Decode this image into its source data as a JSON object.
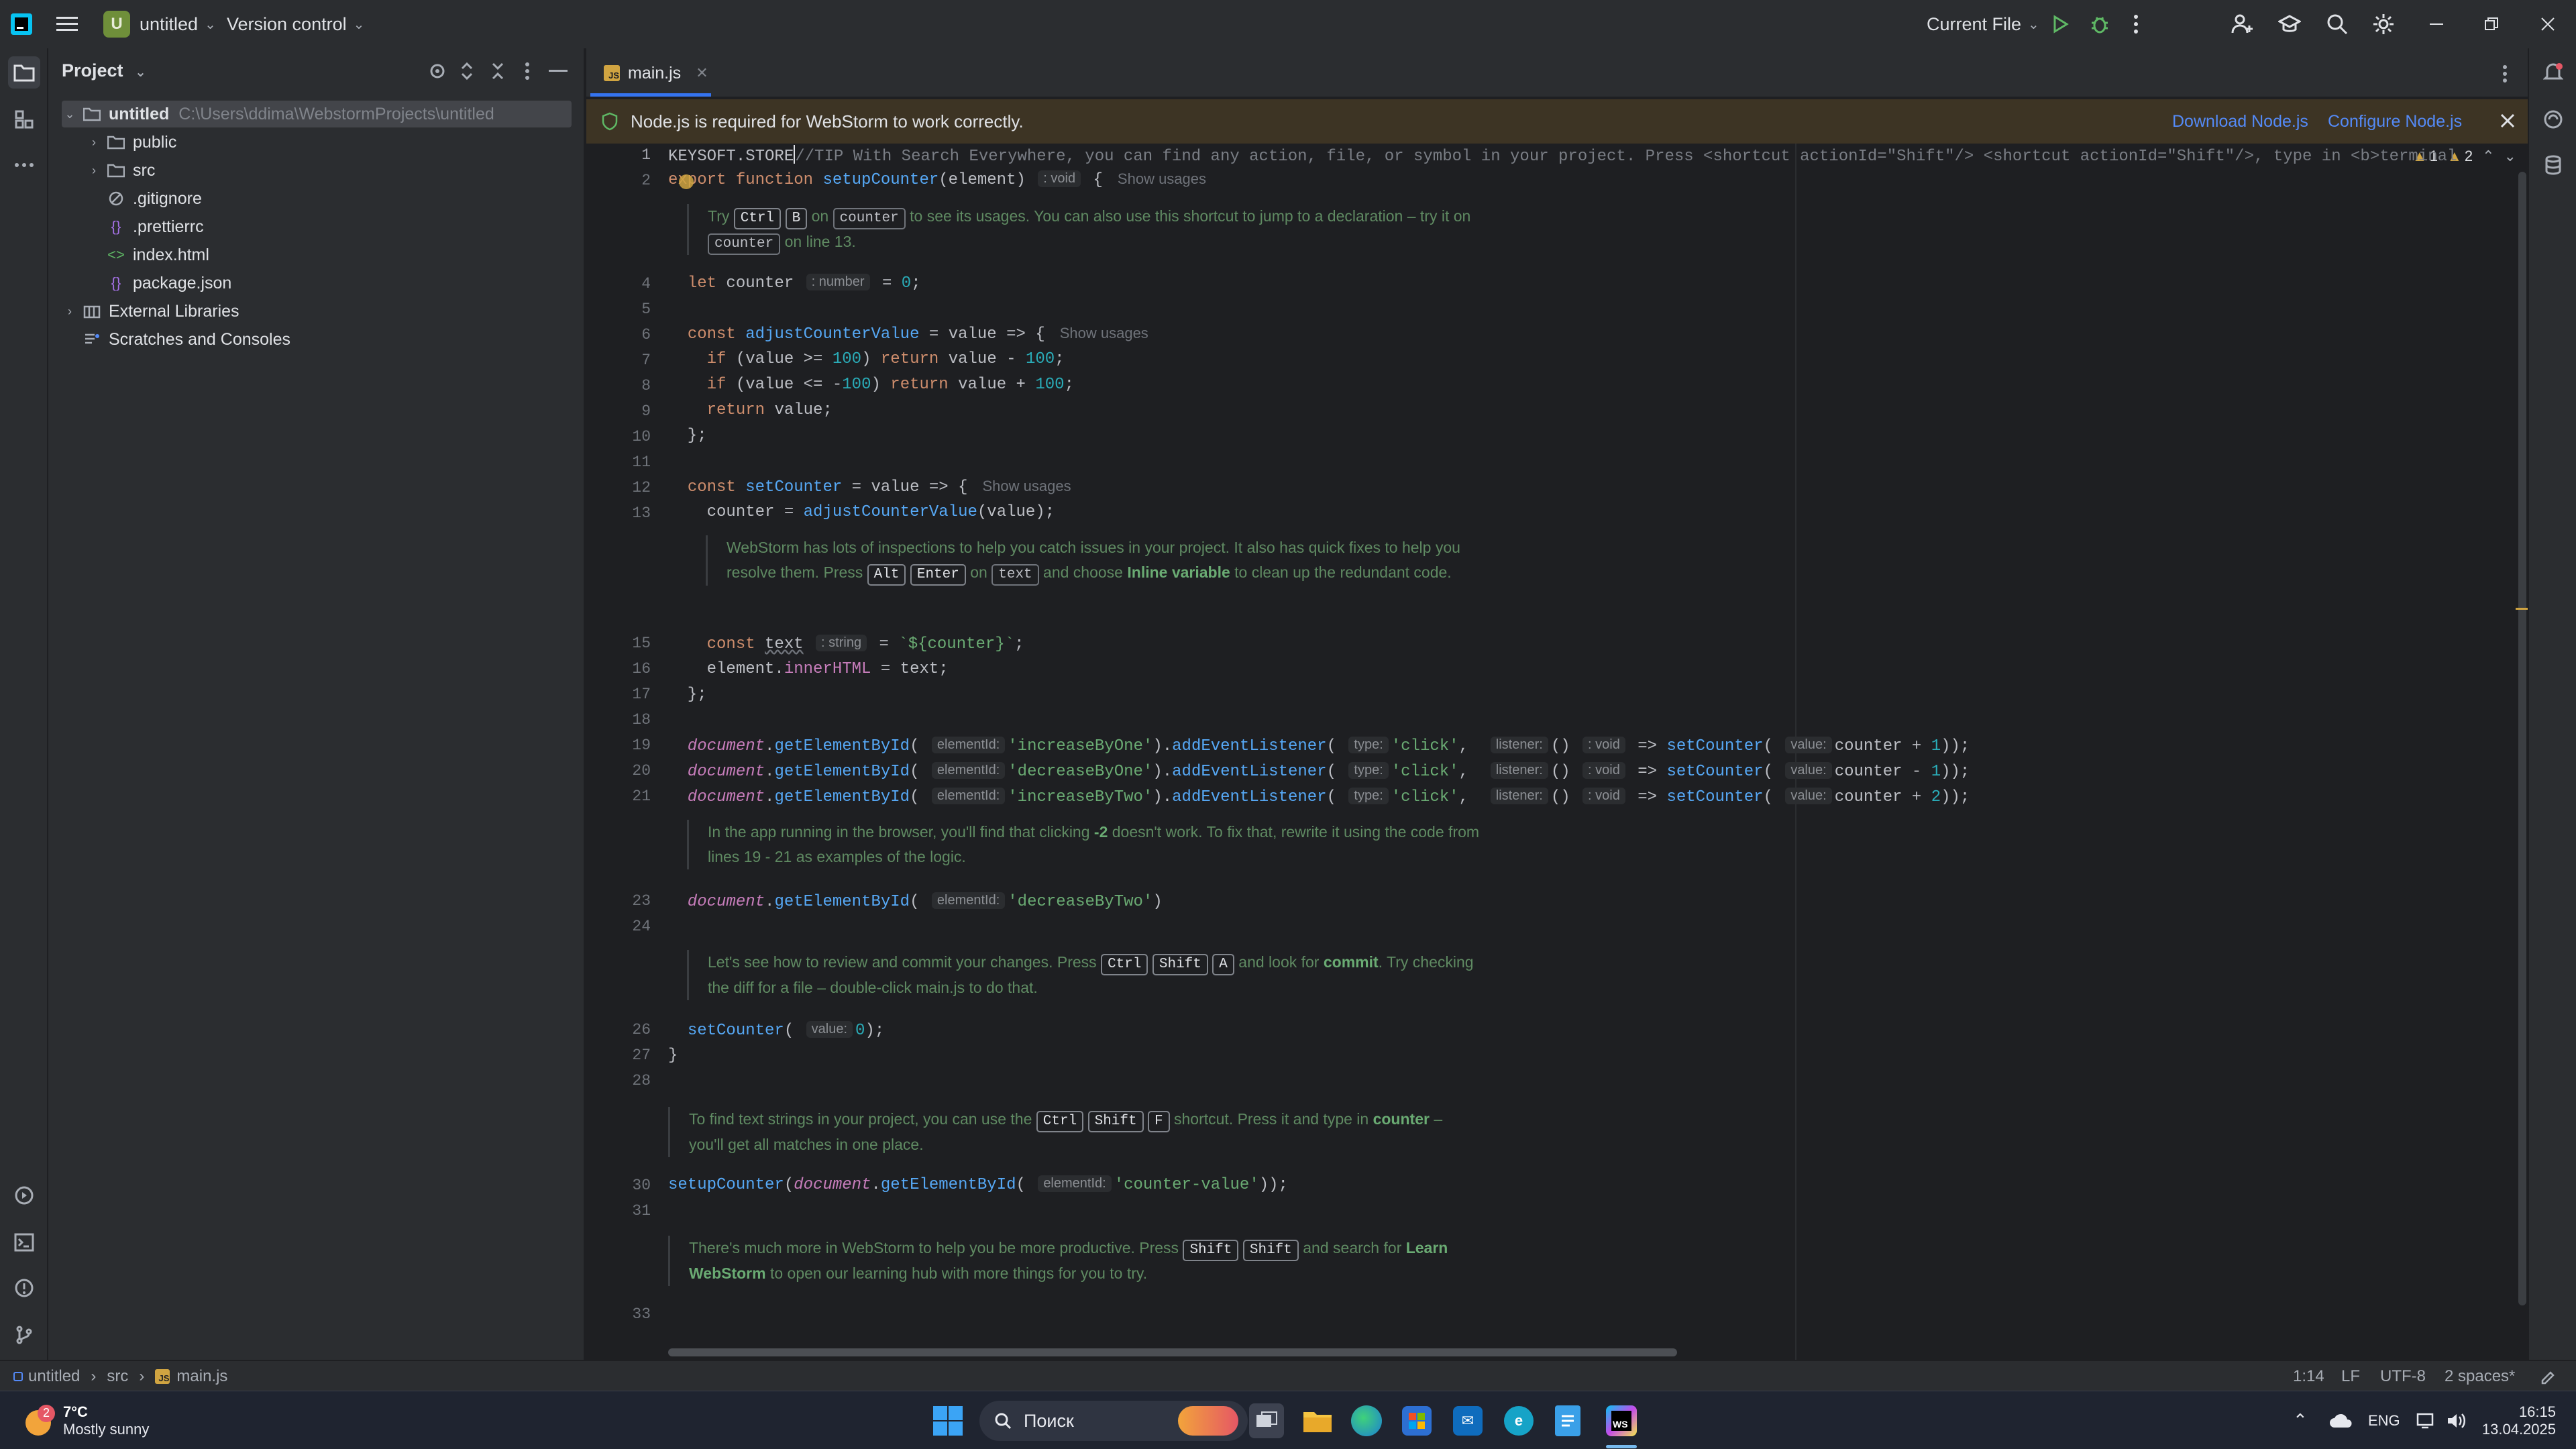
{
  "titlebar": {
    "project_badge": "U",
    "project_name": "untitled",
    "vcs": "Version control",
    "run_config": "Current File"
  },
  "project_panel": {
    "title": "Project",
    "root_name": "untitled",
    "root_path": "C:\\Users\\ddima\\WebstormProjects\\untitled",
    "items": [
      {
        "label": "public",
        "icon": "folder-icon"
      },
      {
        "label": "src",
        "icon": "folder-icon"
      },
      {
        "label": ".gitignore",
        "icon": "gitignore-icon"
      },
      {
        "label": ".prettierrc",
        "icon": "json-icon"
      },
      {
        "label": "index.html",
        "icon": "html-icon"
      },
      {
        "label": "package.json",
        "icon": "json-icon"
      }
    ],
    "external_libraries": "External Libraries",
    "scratches": "Scratches and Consoles"
  },
  "editor": {
    "tab_label": "main.js",
    "js_icon_text": "JS",
    "banner_text": "Node.js is required for WebStorm to work correctly.",
    "banner_download": "Download Node.js",
    "banner_configure": "Configure Node.js",
    "warnings": "1",
    "weak_warnings": "2",
    "line_numbers": [
      "1",
      "2",
      "4",
      "5",
      "6",
      "7",
      "8",
      "9",
      "10",
      "11",
      "12",
      "13",
      "15",
      "16",
      "17",
      "18",
      "19",
      "20",
      "21",
      "23",
      "24",
      "26",
      "27",
      "28",
      "30",
      "31",
      "33"
    ],
    "line1_text": "KEYSOFT.STORE",
    "line1_comment": "//TIP With Search Everywhere, you can find any action, file, or symbol in your project. Press <shortcut actionId=\"Shift\"/> <shortcut actionId=\"Shift\"/>, type in <b>terminal",
    "show_usages": "Show usages",
    "hint_void": ": void",
    "hint_number": ": number",
    "hint_string": ": string",
    "hint_element_id": "elementId:",
    "hint_type": "type:",
    "hint_listener": "listener:",
    "hint_value": "value:",
    "tips": {
      "t1_a": "Try",
      "t1_b": "on",
      "t1_c": "to see its usages. You can also use this shortcut to jump to a declaration –",
      "t1_d": "try it on",
      "t1_e": "on line 13.",
      "t1_chip": "counter",
      "t2_a": "WebStorm has lots of inspections to help you catch issues in your project. It also has quick fixes to help you resolve them. Press",
      "t2_b": "on",
      "t2_c": "and choose",
      "t2_bold": "Inline variable",
      "t2_d": "to clean up the redundant code.",
      "t2_chip": "text",
      "t3_a": "In the app running in the browser, you'll find that clicking",
      "t3_bold": "-2",
      "t3_b": "doesn't work. To fix that, rewrite it using the code from lines 19 - 21 as examples of the logic.",
      "t4_a": "Let's see how to review and commit your changes. Press",
      "t4_b": "and look for",
      "t4_bold": "commit",
      "t4_c": ". Try checking the diff for a file – double-click main.js to do that.",
      "t5_a": "To find text strings in your project, you can use the",
      "t5_b": "shortcut. Press it and type in",
      "t5_bold": "counter",
      "t5_c": "– you'll get all matches in one place.",
      "t6_a": "There's much more in WebStorm to help you be more productive. Press",
      "t6_b": "and search for",
      "t6_bold": "Learn WebStorm",
      "t6_c": "to open our learning hub with more things for you to try."
    },
    "keys": {
      "ctrl": "Ctrl",
      "b": "B",
      "alt": "Alt",
      "enter": "Enter",
      "shift": "Shift",
      "a": "A",
      "f": "F"
    }
  },
  "statusbar": {
    "crumb1": "untitled",
    "crumb2": "src",
    "crumb3": "main.js",
    "position": "1:14",
    "line_sep": "LF",
    "encoding": "UTF-8",
    "indent": "2 spaces*"
  },
  "taskbar": {
    "weather_temp": "7°C",
    "weather_desc": "Mostly sunny",
    "weather_badge": "2",
    "search_label": "Поиск",
    "lang": "ENG",
    "time": "16:15",
    "date": "13.04.2025"
  },
  "colors": {
    "accent": "#3574f0",
    "banner_bg": "#3d3424",
    "editor_bg": "#1e1f22",
    "panel_bg": "#2b2d30"
  }
}
